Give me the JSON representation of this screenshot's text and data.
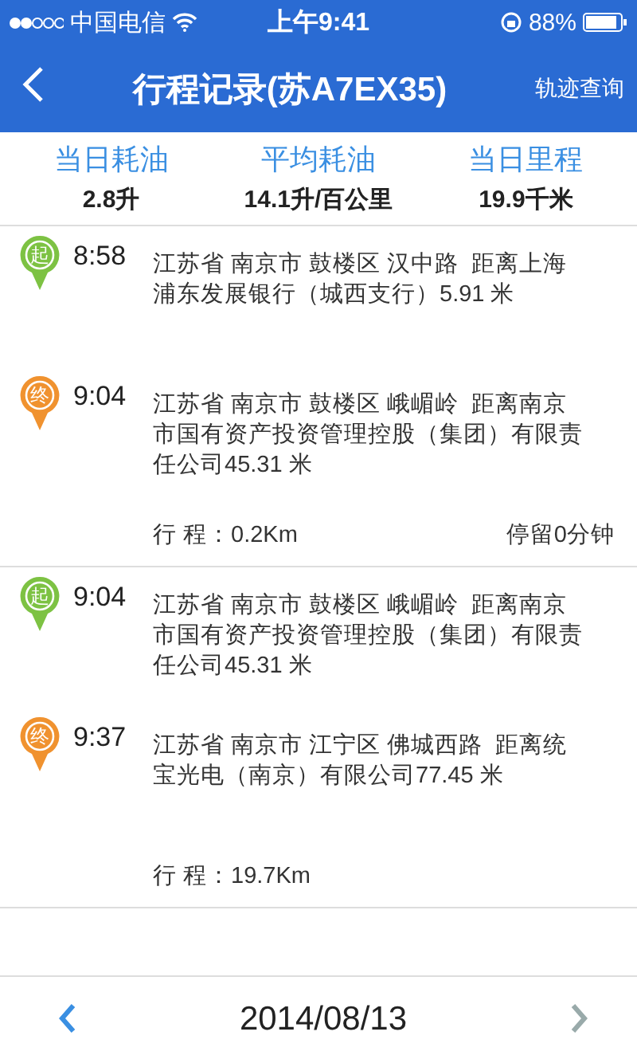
{
  "status_bar": {
    "carrier": "中国电信",
    "time": "上午9:41",
    "battery": "88%"
  },
  "header": {
    "title": "行程记录(苏A7EX35)",
    "action": "轨迹查询"
  },
  "stats": [
    {
      "label": "当日耗油",
      "value": "2.8升"
    },
    {
      "label": "平均耗油",
      "value": "14.1升/百公里"
    },
    {
      "label": "当日里程",
      "value": "19.9千米"
    }
  ],
  "trips": [
    {
      "points": [
        {
          "kind": "start",
          "badge": "起",
          "time": "8:58",
          "address": "江苏省 南京市 鼓楼区 汉中路  距离上海浦东发展银行（城西支行）5.91 米"
        },
        {
          "kind": "end",
          "badge": "终",
          "time": "9:04",
          "address": "江苏省 南京市 鼓楼区 峨嵋岭  距离南京市国有资产投资管理控股（集团）有限责任公司45.31 米"
        }
      ],
      "distance": "行 程：0.2Km",
      "stay": "停留0分钟"
    },
    {
      "points": [
        {
          "kind": "start",
          "badge": "起",
          "time": "9:04",
          "address": "江苏省 南京市 鼓楼区 峨嵋岭  距离南京市国有资产投资管理控股（集团）有限责任公司45.31 米"
        },
        {
          "kind": "end",
          "badge": "终",
          "time": "9:37",
          "address": "江苏省 南京市 江宁区 佛城西路  距离统宝光电（南京）有限公司77.45 米"
        }
      ],
      "distance": "行 程：19.7Km"
    }
  ],
  "footer": {
    "date": "2014/08/13"
  }
}
